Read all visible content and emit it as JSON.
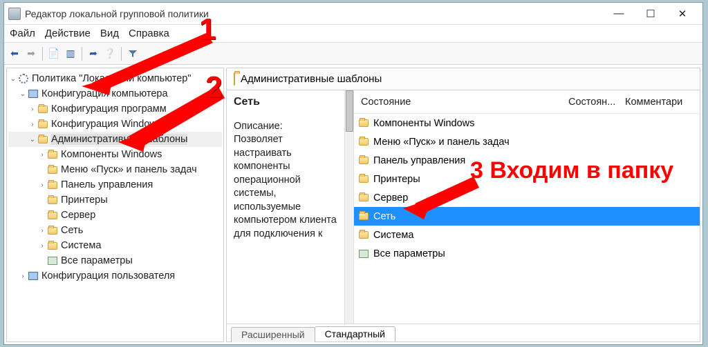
{
  "window": {
    "title": "Редактор локальной групповой политики"
  },
  "menu": {
    "file": "Файл",
    "action": "Действие",
    "view": "Вид",
    "help": "Справка"
  },
  "tree": {
    "root": "Политика \"Локальный компьютер\"",
    "comp_config": "Конфигурация компьютера",
    "software": "Конфигурация программ",
    "windows": "Конфигурация Windows",
    "admin_templates": "Административные шаблоны",
    "components": "Компоненты Windows",
    "startmenu": "Меню «Пуск» и панель задач",
    "control_panel": "Панель управления",
    "printers": "Принтеры",
    "server": "Сервер",
    "network": "Сеть",
    "system": "Система",
    "all_settings": "Все параметры",
    "user_config": "Конфигурация пользователя"
  },
  "right": {
    "header": "Административные шаблоны",
    "heading": "Сеть",
    "desc_label": "Описание:",
    "desc": "Позволяет настраивать компоненты операционной системы, используемые компьютером клиента для подключения к",
    "cols": {
      "c1": "Состояние",
      "c2": "Состоян...",
      "c3": "Комментари"
    },
    "items": [
      "Компоненты Windows",
      "Меню «Пуск» и панель задач",
      "Панель управления",
      "Принтеры",
      "Сервер",
      "Сеть",
      "Система",
      "Все параметры"
    ],
    "selected_index": 5,
    "tabs": {
      "extended": "Расширенный",
      "standard": "Стандартный"
    }
  },
  "annotations": {
    "n1": "1",
    "n2": "2",
    "n3": "3 Входим в папку"
  }
}
